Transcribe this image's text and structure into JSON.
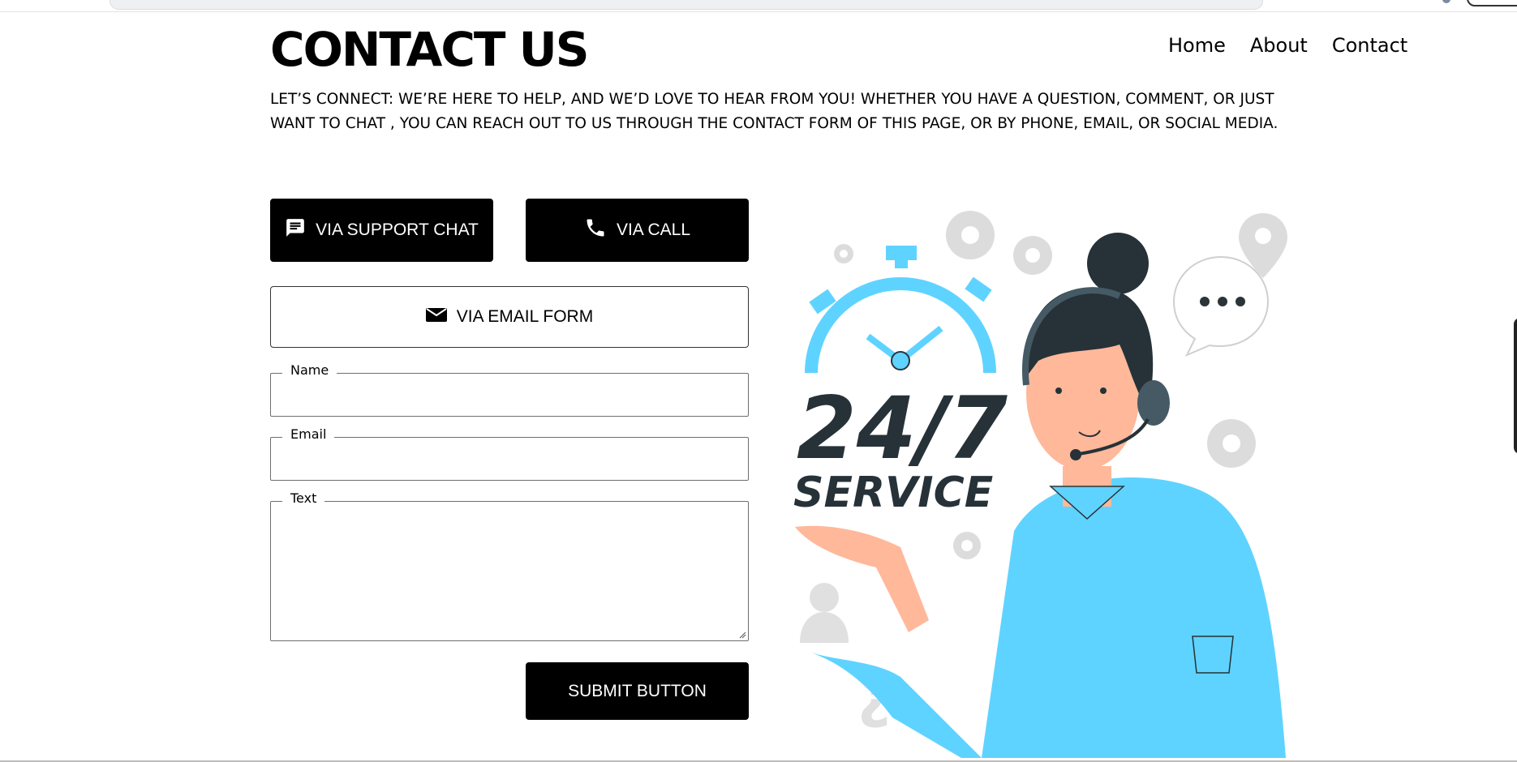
{
  "header": {
    "title": "CONTACT US",
    "nav": [
      "Home",
      "About",
      "Contact"
    ]
  },
  "intro": "LET’S CONNECT: WE’RE HERE TO HELP, AND WE’D LOVE TO HEAR FROM YOU! WHETHER YOU HAVE A QUESTION, COMMENT, OR JUST WANT TO CHAT , YOU CAN REACH OUT TO US THROUGH THE CONTACT FORM OF THIS PAGE, OR BY PHONE, EMAIL, OR SOCIAL MEDIA.",
  "buttons": {
    "support_chat": "VIA SUPPORT CHAT",
    "call": "VIA CALL",
    "email_form": "VIA EMAIL FORM",
    "submit": "SUBMIT BUTTON"
  },
  "form": {
    "name_label": "Name",
    "email_label": "Email",
    "text_label": "Text"
  },
  "illustration": {
    "number": "24/7",
    "word": "SERVICE",
    "accent_color": "#5fd3ff"
  }
}
